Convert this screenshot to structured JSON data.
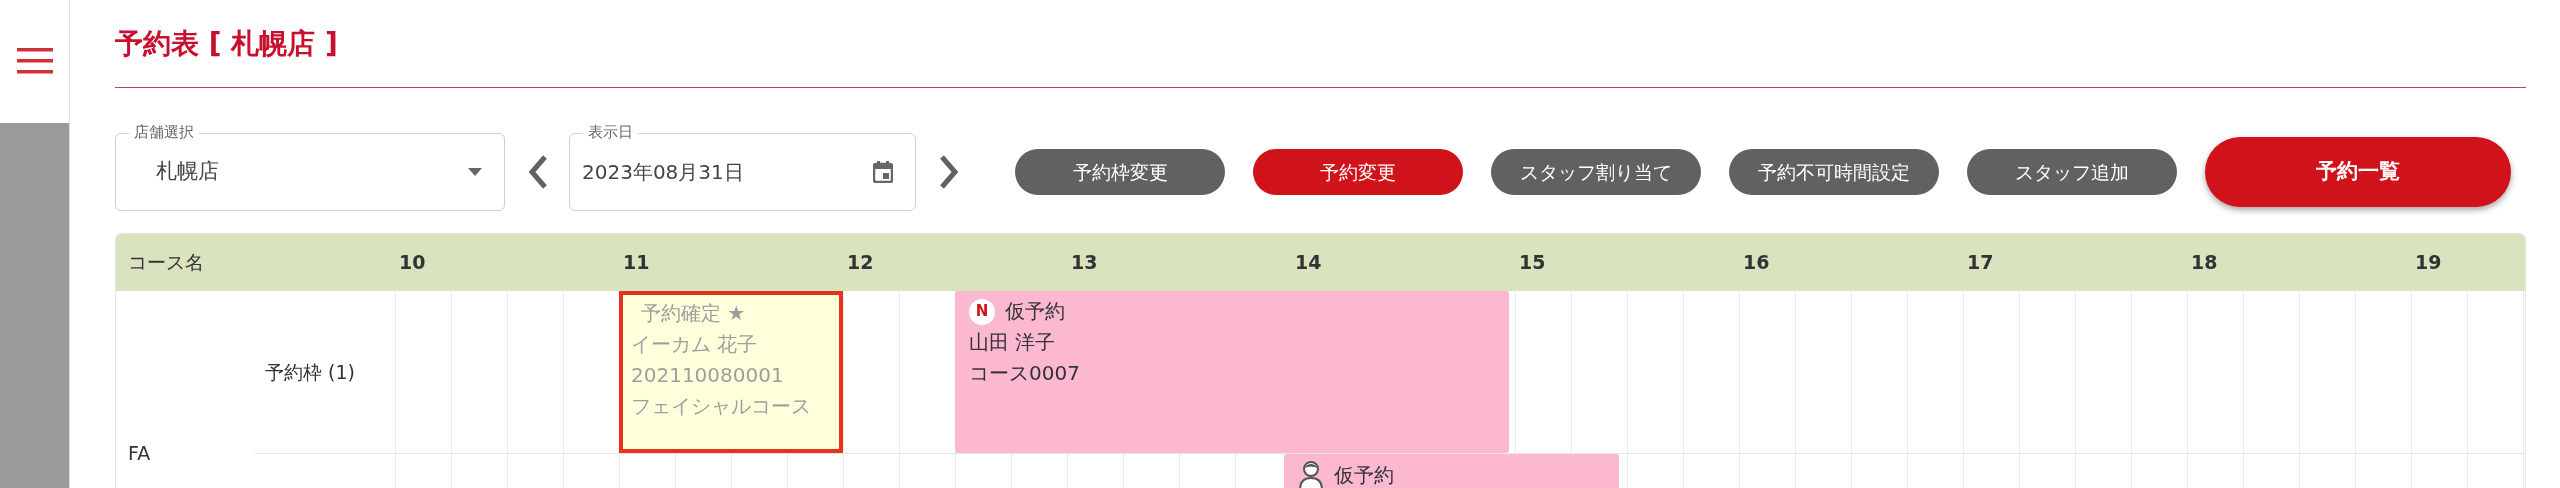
{
  "page_title": "予約表 [ 札幌店 ]",
  "store_select": {
    "label": "店舗選択",
    "value": "札幌店"
  },
  "date_field": {
    "label": "表示日",
    "value": "2023年08月31日"
  },
  "buttons": [
    {
      "label": "予約枠変更",
      "kind": "secondary"
    },
    {
      "label": "予約変更",
      "kind": "accent"
    },
    {
      "label": "スタッフ割り当て",
      "kind": "secondary"
    },
    {
      "label": "予約不可時間設定",
      "kind": "secondary"
    },
    {
      "label": "スタッフ追加",
      "kind": "secondary"
    },
    {
      "label": "予約一覧",
      "kind": "primary"
    }
  ],
  "schedule": {
    "columns": [
      "コース名",
      "10",
      "11",
      "12",
      "13",
      "14",
      "15",
      "16",
      "17",
      "18",
      "19"
    ],
    "courses": [
      {
        "name": "FA",
        "slots": [
          {
            "label": "予約枠 (1)",
            "bookings": [
              {
                "kind": "confirmed",
                "selected": true,
                "lines": [
                  "予約確定 ★",
                  "イーカム 花子",
                  "202110080001",
                  "フェイシャルコース"
                ]
              },
              {
                "kind": "tentative",
                "selected": false,
                "badge": "N",
                "staff_assigned": false,
                "lines": [
                  "仮予約",
                  "山田 洋子",
                  "コース0007"
                ]
              }
            ]
          },
          {
            "bookings": [
              {
                "kind": "tentative",
                "selected": false,
                "staff_assigned": true,
                "lines": [
                  "仮予約"
                ]
              }
            ]
          }
        ]
      }
    ]
  }
}
